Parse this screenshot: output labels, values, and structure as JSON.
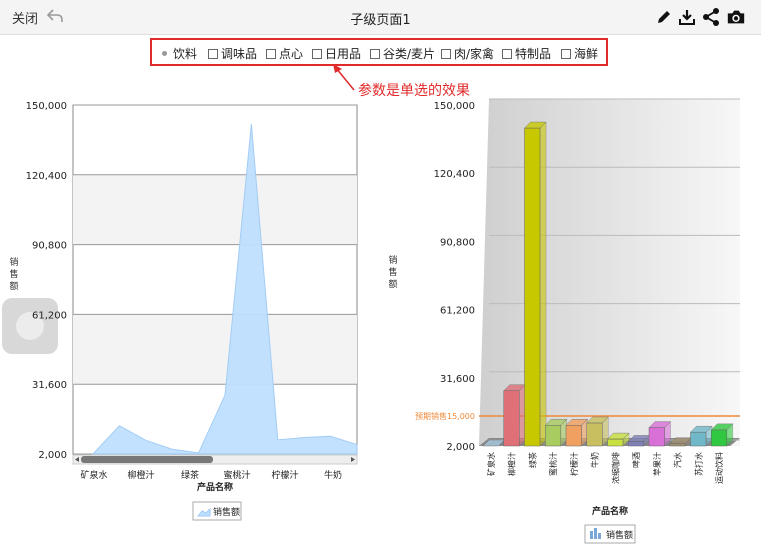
{
  "header": {
    "close_label": "关闭",
    "title": "子级页面1"
  },
  "filter": {
    "selected": "饮料",
    "options": [
      {
        "label": "饮料",
        "kind": "radio"
      },
      {
        "label": "调味品",
        "kind": "checkbox"
      },
      {
        "label": "点心",
        "kind": "checkbox"
      },
      {
        "label": "日用品",
        "kind": "checkbox"
      },
      {
        "label": "谷类/麦片",
        "kind": "checkbox"
      },
      {
        "label": "肉/家禽",
        "kind": "checkbox"
      },
      {
        "label": "特制品",
        "kind": "checkbox"
      },
      {
        "label": "海鲜",
        "kind": "checkbox"
      }
    ]
  },
  "annotation": "参数是单选的效果",
  "colors": {
    "accent_red": "#e12b2b",
    "area_fill": "#bfe0ff",
    "area_stroke": "#9fcaf5",
    "ref_line": "#f08a3a"
  },
  "chart_data": [
    {
      "type": "area",
      "ylabel": "销售额",
      "xlabel": "产品名称",
      "legend": "销售额",
      "ylim": [
        2000,
        150000
      ],
      "yticks": [
        "150,000",
        "120,400",
        "90,800",
        "61,200",
        "31,600",
        "2,000"
      ],
      "tick_values": [
        150000,
        120400,
        90800,
        61200,
        31600,
        2000
      ],
      "categories": [
        "矿泉水",
        "柳橙汁",
        "绿茶",
        "蜜桃汁",
        "柠檬汁",
        "牛奶"
      ],
      "values": [
        2000,
        14000,
        7800,
        4000,
        2500,
        27000,
        142000,
        8000,
        9000,
        9500,
        6000
      ]
    },
    {
      "type": "bar",
      "ylabel": "销售额",
      "xlabel": "产品名称",
      "legend": "销售额",
      "ylim": [
        2000,
        150000
      ],
      "yticks": [
        "150,000",
        "120,400",
        "90,800",
        "61,200",
        "31,600",
        "2,000"
      ],
      "tick_values": [
        150000,
        120400,
        90800,
        61200,
        31600,
        2000
      ],
      "reference": {
        "label": "预期销售15,000",
        "value": 15000
      },
      "categories": [
        "矿泉水",
        "柳橙汁",
        "绿茶",
        "蜜桃汁",
        "柠檬汁",
        "牛奶",
        "浓缩咖啡",
        "啤酒",
        "苹果汁",
        "汽水",
        "苏打水",
        "运动饮料"
      ],
      "values": [
        2000,
        26000,
        140000,
        11000,
        11000,
        12000,
        5000,
        4000,
        10000,
        3000,
        8000,
        9000
      ],
      "colors": [
        "#a8c8e0",
        "#e07078",
        "#c8c800",
        "#a8cc60",
        "#f0a060",
        "#c8c060",
        "#c8e040",
        "#8080b8",
        "#d870d8",
        "#a09070",
        "#70b8c8",
        "#30c840"
      ]
    }
  ]
}
